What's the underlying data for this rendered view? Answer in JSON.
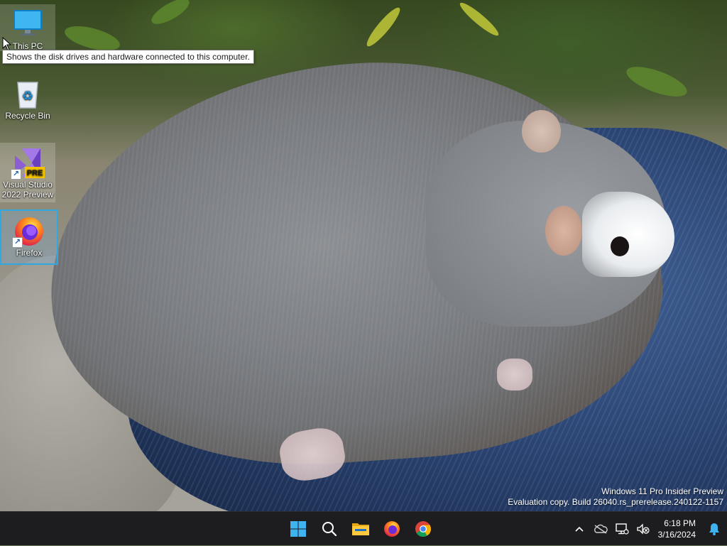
{
  "desktop": {
    "icons": [
      {
        "label": "This PC"
      },
      {
        "label": "Recycle Bin"
      },
      {
        "label": "Visual Studio 2022 Preview",
        "badge": "PRE"
      },
      {
        "label": "Firefox"
      }
    ],
    "tooltip": "Shows the disk drives and hardware connected to this computer."
  },
  "watermark": {
    "line1": "Windows 11 Pro Insider Preview",
    "line2": "Evaluation copy. Build 26040.rs_prerelease.240122-1157"
  },
  "taskbar": {
    "apps": [
      {
        "name": "start-button-icon"
      },
      {
        "name": "search-icon"
      },
      {
        "name": "file-explorer-icon"
      },
      {
        "name": "firefox-icon"
      },
      {
        "name": "chrome-icon"
      }
    ],
    "tray": {
      "icons": [
        "chevron-up-icon",
        "onedrive-icon",
        "network-icon",
        "volume-muted-icon"
      ],
      "time": "6:18 PM",
      "date": "3/16/2024",
      "notification_icon": "bell-icon"
    },
    "accent": "#2fa8e0"
  }
}
